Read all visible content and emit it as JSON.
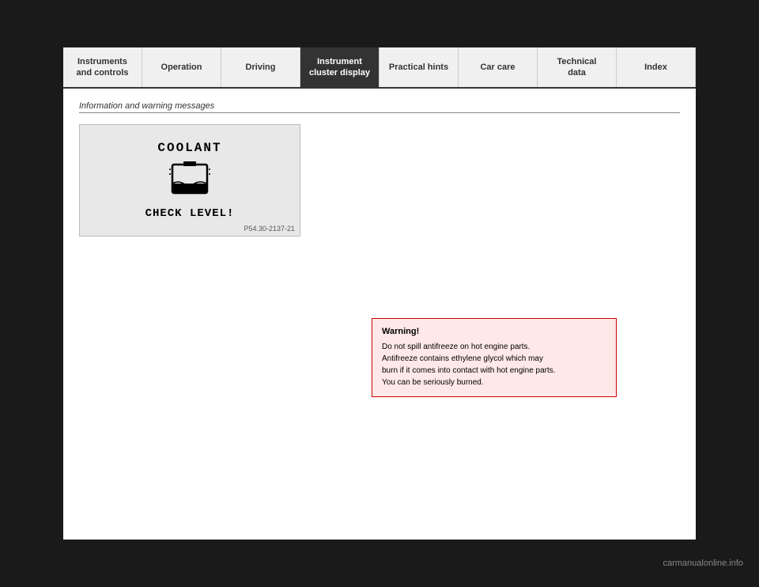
{
  "nav": {
    "items": [
      {
        "id": "instruments",
        "label": "Instruments\nand controls",
        "active": false
      },
      {
        "id": "operation",
        "label": "Operation",
        "active": false
      },
      {
        "id": "driving",
        "label": "Driving",
        "active": false
      },
      {
        "id": "instrument-cluster",
        "label": "Instrument\ncluster display",
        "active": true
      },
      {
        "id": "practical-hints",
        "label": "Practical hints",
        "active": false
      },
      {
        "id": "car-care",
        "label": "Car care",
        "active": false
      },
      {
        "id": "technical-data",
        "label": "Technical\ndata",
        "active": false
      },
      {
        "id": "index",
        "label": "Index",
        "active": false
      }
    ]
  },
  "section": {
    "title": "Information and warning messages"
  },
  "display": {
    "coolant_label": "COOLANT",
    "check_level_label": "CHECK LEVEL!",
    "image_ref": "P54.30-2137-21"
  },
  "warning": {
    "title": "Warning!",
    "lines": [
      "Do not spill antifreeze on hot engine parts.",
      "Antifreeze contains ethylene glycol which may",
      "burn if it comes into contact with hot engine parts.",
      "You can be seriously burned."
    ]
  },
  "footer": {
    "watermark": "carmanualonline.info"
  }
}
